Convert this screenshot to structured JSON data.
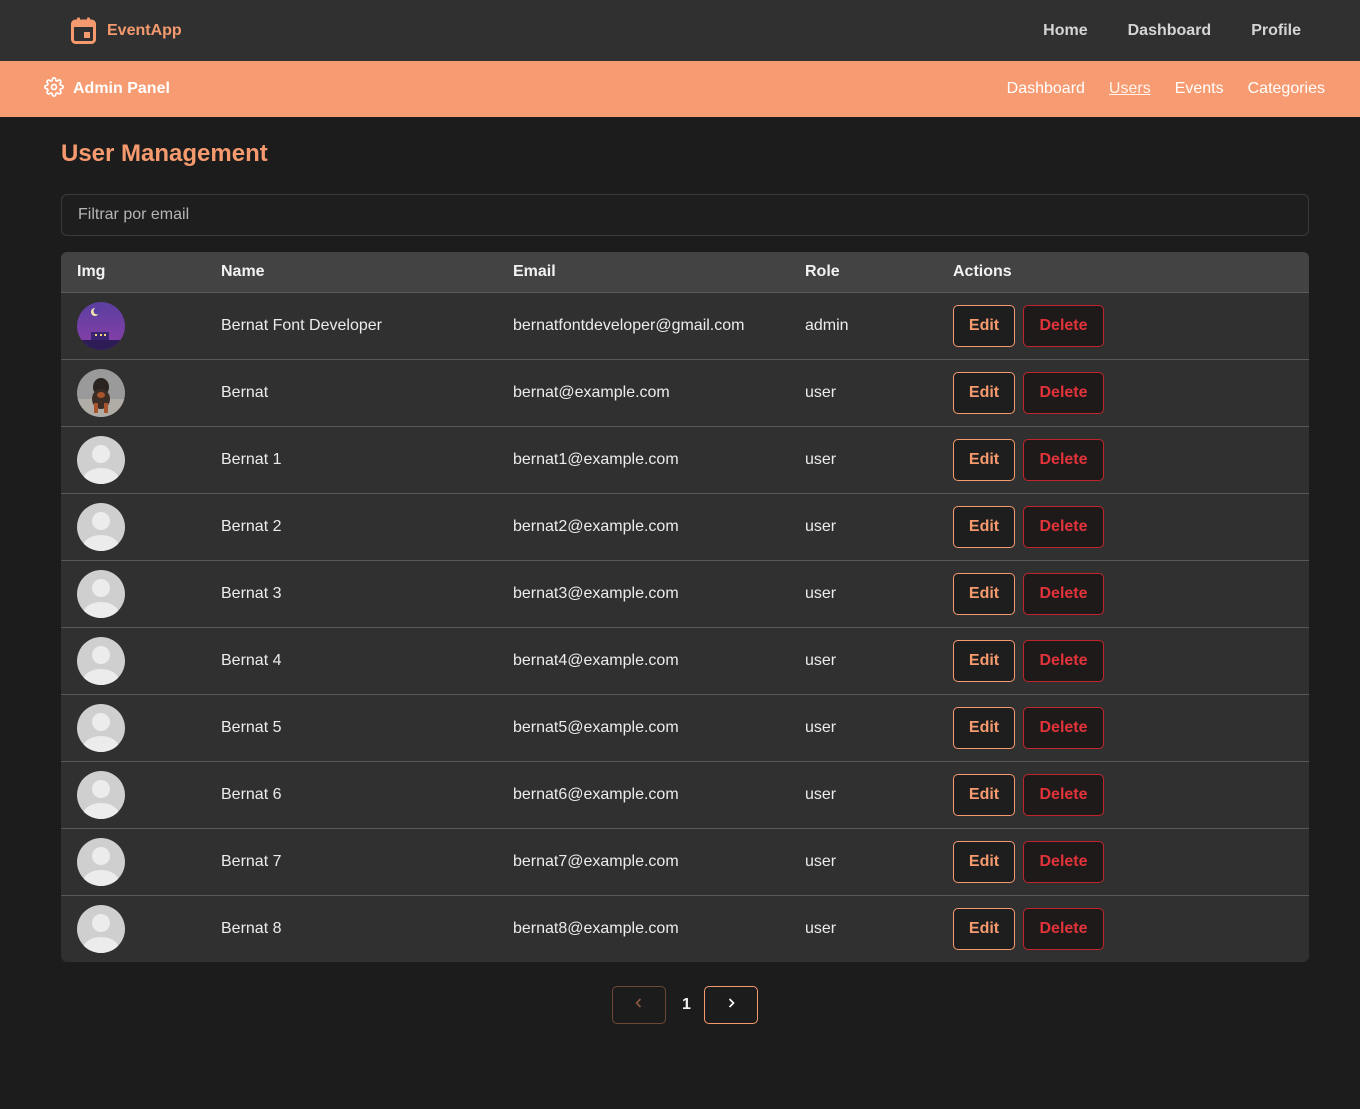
{
  "app": {
    "name": "EventApp"
  },
  "topnav": {
    "home": "Home",
    "dashboard": "Dashboard",
    "profile": "Profile"
  },
  "admin": {
    "title": "Admin Panel",
    "nav": {
      "dashboard": "Dashboard",
      "users": "Users",
      "events": "Events",
      "categories": "Categories"
    },
    "active_tab": "Users"
  },
  "page": {
    "title": "User Management"
  },
  "filter": {
    "placeholder": "Filtrar por email",
    "value": ""
  },
  "table": {
    "headers": {
      "img": "Img",
      "name": "Name",
      "email": "Email",
      "role": "Role",
      "actions": "Actions"
    },
    "edit_label": "Edit",
    "delete_label": "Delete",
    "rows": [
      {
        "avatar": "night-scene-avatar",
        "name": "Bernat Font Developer",
        "email": "bernatfontdeveloper@gmail.com",
        "role": "admin"
      },
      {
        "avatar": "dog-photo-avatar",
        "name": "Bernat",
        "email": "bernat@example.com",
        "role": "user"
      },
      {
        "avatar": "default-avatar",
        "name": "Bernat 1",
        "email": "bernat1@example.com",
        "role": "user"
      },
      {
        "avatar": "default-avatar",
        "name": "Bernat 2",
        "email": "bernat2@example.com",
        "role": "user"
      },
      {
        "avatar": "default-avatar",
        "name": "Bernat 3",
        "email": "bernat3@example.com",
        "role": "user"
      },
      {
        "avatar": "default-avatar",
        "name": "Bernat 4",
        "email": "bernat4@example.com",
        "role": "user"
      },
      {
        "avatar": "default-avatar",
        "name": "Bernat 5",
        "email": "bernat5@example.com",
        "role": "user"
      },
      {
        "avatar": "default-avatar",
        "name": "Bernat 6",
        "email": "bernat6@example.com",
        "role": "user"
      },
      {
        "avatar": "default-avatar",
        "name": "Bernat 7",
        "email": "bernat7@example.com",
        "role": "user"
      },
      {
        "avatar": "default-avatar",
        "name": "Bernat 8",
        "email": "bernat8@example.com",
        "role": "user"
      }
    ]
  },
  "pagination": {
    "current_page": "1",
    "prev_icon": "chevron-left-icon",
    "next_icon": "chevron-right-icon"
  },
  "colors": {
    "accent": "#f59a6e",
    "admin_bar": "#f79c72",
    "danger": "#e3333a",
    "background": "#1c1c1c"
  }
}
